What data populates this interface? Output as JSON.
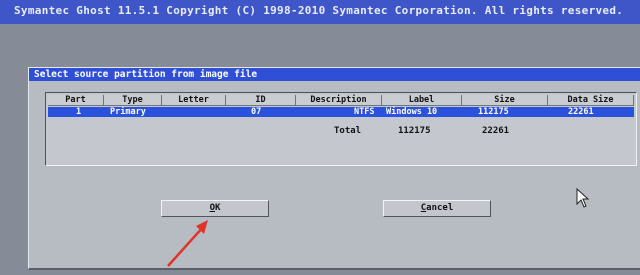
{
  "window": {
    "title": "Symantec Ghost 11.5.1   Copyright (C) 1998-2010 Symantec Corporation. All rights reserved."
  },
  "dialog": {
    "title": "Select source partition from image file",
    "columns": [
      "Part",
      "Type",
      "Letter",
      "ID",
      "Description",
      "Label",
      "Size",
      "Data Size"
    ],
    "rows": [
      {
        "part": "1",
        "type": "Primary",
        "letter": "",
        "id": "07",
        "description": "NTFS",
        "label": "Windows 10",
        "size": "112175",
        "data_size": "22261"
      }
    ],
    "total": {
      "label": "Total",
      "size": "112175",
      "data_size": "22261"
    },
    "ok": {
      "underline": "O",
      "rest": "K"
    },
    "cancel": {
      "underline": "C",
      "rest": "ancel"
    }
  },
  "colors": {
    "selection": "#2a52dc",
    "title_bar": "#2f4fd6",
    "annotation_arrow": "#e0342a"
  },
  "icons": {
    "annotation": "red-arrow-icon",
    "pointer": "mouse-cursor-icon"
  }
}
